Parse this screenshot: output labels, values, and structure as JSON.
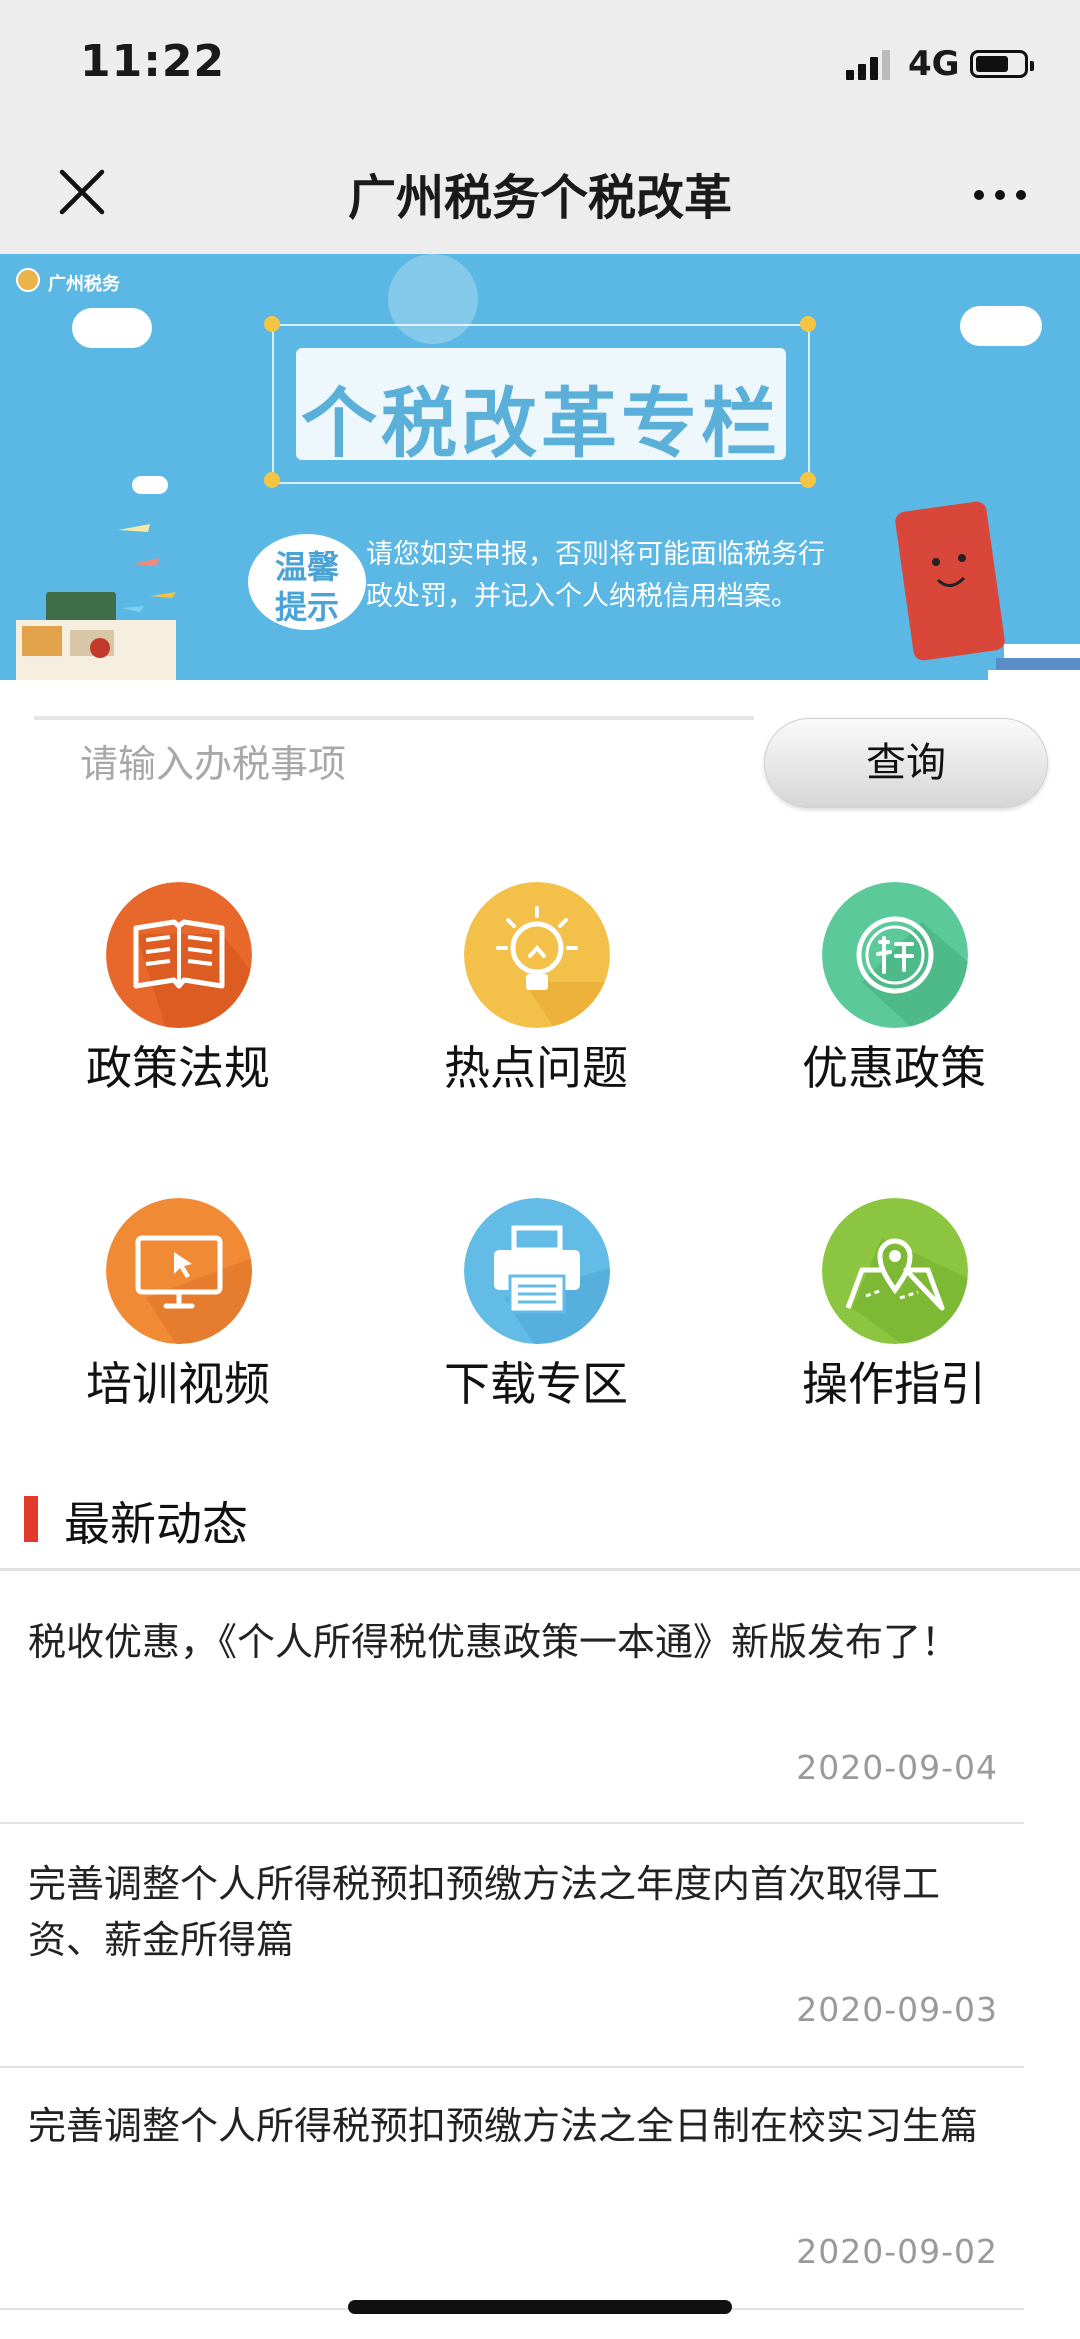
{
  "status_bar": {
    "time": "11:22",
    "network": "4G"
  },
  "nav": {
    "title": "广州税务个税改革"
  },
  "banner": {
    "brand": "广州税务",
    "headline": "个税改革专栏",
    "reminder_label_1": "温馨",
    "reminder_label_2": "提示",
    "reminder_line_1": "请您如实申报，否则将可能面临税务行",
    "reminder_line_2": "政处罚，并记入个人纳税信用档案。"
  },
  "search": {
    "placeholder": "请输入办税事项",
    "button_label": "查询"
  },
  "menu": {
    "items": [
      {
        "label": "政策法规",
        "icon": "book-icon",
        "color": "#e8672a"
      },
      {
        "label": "热点问题",
        "icon": "lightbulb-icon",
        "color": "#f3c04a"
      },
      {
        "label": "优惠政策",
        "icon": "tax-seal-icon",
        "color": "#5cc99a"
      },
      {
        "label": "培训视频",
        "icon": "monitor-icon",
        "color": "#f08a34"
      },
      {
        "label": "下载专区",
        "icon": "printer-icon",
        "color": "#63bce6"
      },
      {
        "label": "操作指引",
        "icon": "map-pin-icon",
        "color": "#8cc640"
      }
    ]
  },
  "news": {
    "section_title": "最新动态",
    "items": [
      {
        "title": "税收优惠，《个人所得税优惠政策一本通》新版发布了！",
        "date": "2020-09-04"
      },
      {
        "title": "完善调整个人所得税预扣预缴方法之年度内首次取得工资、薪金所得篇",
        "date": "2020-09-03"
      },
      {
        "title": "完善调整个人所得税预扣预缴方法之全日制在校实习生篇",
        "date": "2020-09-02"
      }
    ]
  }
}
